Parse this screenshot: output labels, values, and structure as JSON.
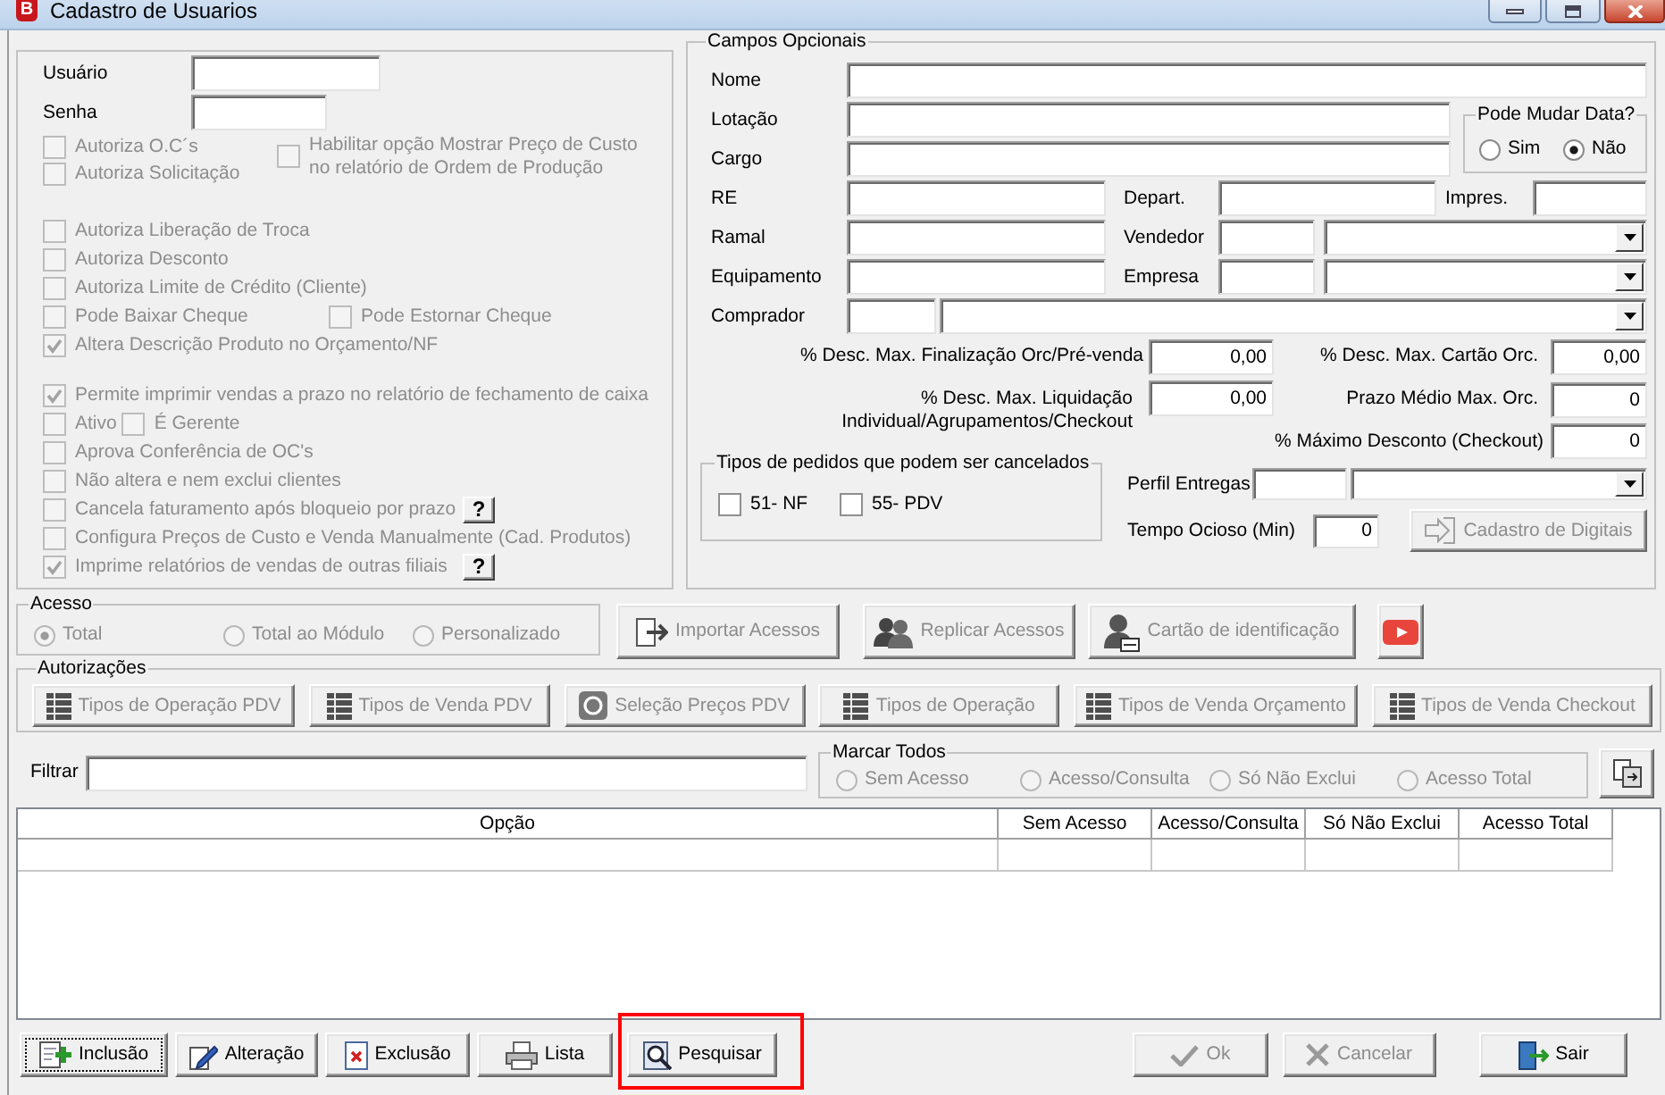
{
  "window": {
    "logo_text": "B",
    "title": "Cadastro de Usuarios"
  },
  "credentials": [
    {
      "label": "Usuário"
    },
    {
      "label": "Senha"
    }
  ],
  "permissions": {
    "disabled": true,
    "sections": [
      {
        "kind": "columns",
        "columns": [
          [
            {
              "label": "Autoriza O.C´s",
              "checked": false
            },
            {
              "label": "Autoriza Solicitação",
              "checked": false
            }
          ],
          [
            {
              "label": "Habilitar opção Mostrar Preço de Custo\nno relatório de Ordem de Produção",
              "checked": false
            }
          ]
        ]
      },
      {
        "kind": "rows",
        "rows": [
          {
            "kind": "spaced",
            "items": [
              {
                "label": "Autoriza Liberação de Troca",
                "checked": false
              }
            ]
          },
          {
            "kind": "spaced",
            "items": [
              {
                "label": "Autoriza Desconto",
                "checked": false
              }
            ]
          },
          {
            "kind": "spaced",
            "items": [
              {
                "label": "Autoriza Limite de Crédito (Cliente)",
                "checked": false
              }
            ]
          },
          {
            "kind": "spaced",
            "items": [
              {
                "label": "Pode Baixar Cheque",
                "checked": false
              },
              {
                "label": "Pode Estornar Cheque",
                "checked": false
              }
            ]
          },
          {
            "kind": "spaced",
            "items": [
              {
                "label": "Altera Descrição Produto no Orçamento/NF",
                "checked": true
              }
            ]
          }
        ]
      },
      {
        "kind": "rows",
        "rows": [
          {
            "kind": "spaced",
            "items": [
              {
                "label": "Permite imprimir vendas a prazo no relatório de fechamento de caixa",
                "checked": true
              }
            ]
          },
          {
            "kind": "packed",
            "items": [
              {
                "label": "Ativo",
                "checked": false
              },
              {
                "label": "É Gerente",
                "checked": false
              }
            ]
          },
          {
            "kind": "spaced",
            "items": [
              {
                "label": "Aprova Conferência de OC's",
                "checked": false
              }
            ]
          },
          {
            "kind": "spaced",
            "items": [
              {
                "label": "Não altera e nem exclui clientes",
                "checked": false
              }
            ]
          },
          {
            "kind": "spaced",
            "items": [
              {
                "label": "Cancela faturamento após bloqueio por prazo",
                "checked": false,
                "help": "?"
              }
            ]
          },
          {
            "kind": "spaced",
            "items": [
              {
                "label": "Configura Preços de Custo e Venda Manualmente (Cad. Produtos)",
                "checked": false
              }
            ]
          },
          {
            "kind": "spaced",
            "items": [
              {
                "label": "Imprime relatórios de vendas de outras filiais",
                "checked": true,
                "help": "?"
              }
            ]
          }
        ]
      }
    ]
  },
  "optional_fields": {
    "title": "Campos Opcionais",
    "name": {
      "label": "Nome"
    },
    "location": {
      "label": "Lotação"
    },
    "job_title": {
      "label": "Cargo"
    },
    "date_change": {
      "title": "Pode Mudar Data?",
      "options": [
        {
          "label": "Sim",
          "selected": false
        },
        {
          "label": "Não",
          "selected": true
        }
      ]
    },
    "registration": {
      "label": "RE"
    },
    "department": {
      "label": "Depart."
    },
    "printer": {
      "label": "Impres."
    },
    "extension": {
      "label": "Ramal"
    },
    "seller": {
      "label": "Vendedor"
    },
    "equipment": {
      "label": "Equipamento"
    },
    "company": {
      "label": "Empresa"
    },
    "buyer": {
      "label": "Comprador"
    },
    "limits": [
      {
        "label": "% Desc. Max. Finalização Orc/Pré-venda",
        "value": "0,00"
      },
      {
        "label": "% Desc. Max. Cartão Orc.",
        "value": "0,00"
      },
      {
        "label": "% Desc. Max. Liquidação\nIndividual/Agrupamentos/Checkout",
        "value": "0,00"
      },
      {
        "label": "Prazo Médio Max. Orc.",
        "value": "0"
      },
      {
        "label": "% Máximo Desconto (Checkout)",
        "value": "0"
      }
    ],
    "cancellable_orders": {
      "title": "Tipos de pedidos que podem ser cancelados",
      "options": [
        {
          "label": "51- NF",
          "checked": false
        },
        {
          "label": "55- PDV",
          "checked": false
        }
      ]
    },
    "delivery_profile": {
      "label": "Perfil Entregas"
    },
    "idle_time": {
      "label": "Tempo Ocioso (Min)",
      "value": "0"
    },
    "fingerprint_button": {
      "label": "Cadastro de Digitais",
      "disabled": true
    }
  },
  "access": {
    "title": "Acesso",
    "disabled": true,
    "options": [
      {
        "label": "Total",
        "selected": true
      },
      {
        "label": "Total ao Módulo",
        "selected": false
      },
      {
        "label": "Personalizado",
        "selected": false
      }
    ]
  },
  "access_buttons": [
    {
      "label": "Importar Acessos",
      "disabled": true
    },
    {
      "label": "Replicar Acessos",
      "disabled": true
    },
    {
      "label": "Cartão de identificação",
      "disabled": true
    },
    {
      "disabled": false
    }
  ],
  "authorizations": {
    "title": "Autorizações",
    "buttons": [
      {
        "label": "Tipos de Operação PDV",
        "disabled": true
      },
      {
        "label": "Tipos de Venda PDV",
        "disabled": true
      },
      {
        "label": "Seleção Preços PDV",
        "disabled": true
      },
      {
        "label": "Tipos de Operação",
        "disabled": true
      },
      {
        "label": "Tipos de Venda Orçamento",
        "disabled": true
      },
      {
        "label": "Tipos de Venda Checkout",
        "disabled": true
      }
    ]
  },
  "filter": {
    "label": "Filtrar"
  },
  "mark_all": {
    "title": "Marcar Todos",
    "disabled": true,
    "options": [
      {
        "label": "Sem Acesso",
        "selected": false
      },
      {
        "label": "Acesso/Consulta",
        "selected": false
      },
      {
        "label": "Só Não Exclui",
        "selected": false
      },
      {
        "label": "Acesso Total",
        "selected": false
      }
    ]
  },
  "table": {
    "columns": [
      "Opção",
      "Sem Acesso",
      "Acesso/Consulta",
      "Só Não Exclui",
      "Acesso Total"
    ]
  },
  "record_buttons": [
    {
      "label": "Inclusão",
      "focused": true,
      "highlighted": false
    },
    {
      "label": "Alteração",
      "focused": false,
      "highlighted": false
    },
    {
      "label": "Exclusão",
      "focused": false,
      "highlighted": false
    },
    {
      "label": "Lista",
      "focused": false,
      "highlighted": false
    },
    {
      "label": "Pesquisar",
      "focused": false,
      "highlighted": true
    }
  ],
  "confirm_buttons": [
    {
      "label": "Ok",
      "disabled": true
    },
    {
      "label": "Cancelar",
      "disabled": true
    }
  ],
  "exit_button": {
    "label": "Sair"
  }
}
